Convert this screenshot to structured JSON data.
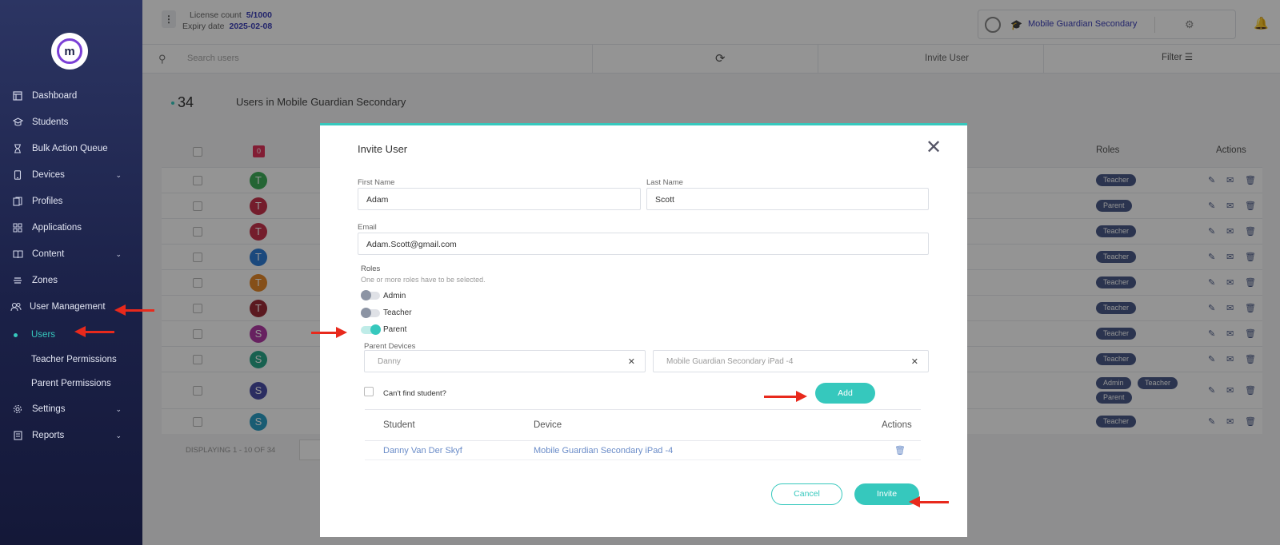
{
  "sidebar": {
    "logo_letter": "m",
    "items": [
      {
        "label": "Dashboard",
        "icon": "dashboard-icon"
      },
      {
        "label": "Students",
        "icon": "students-icon"
      },
      {
        "label": "Bulk Action Queue",
        "icon": "hourglass-icon"
      },
      {
        "label": "Devices",
        "icon": "device-icon"
      },
      {
        "label": "Profiles",
        "icon": "profiles-icon"
      },
      {
        "label": "Applications",
        "icon": "grid-icon"
      },
      {
        "label": "Content",
        "icon": "book-icon"
      },
      {
        "label": "Zones",
        "icon": "zones-icon"
      },
      {
        "label": "User Management",
        "icon": "users-icon"
      },
      {
        "label": "Settings",
        "icon": "gear-icon"
      },
      {
        "label": "Reports",
        "icon": "reports-icon"
      }
    ],
    "sub_items": [
      {
        "label": "Users"
      },
      {
        "label": "Teacher Permissions"
      },
      {
        "label": "Parent Permissions"
      }
    ]
  },
  "topbar": {
    "license_label": "License count",
    "license_value": "5/1000",
    "expiry_label": "Expiry date",
    "expiry_value": "2025-02-08",
    "school_name": "Mobile Guardian Secondary"
  },
  "toolbar": {
    "search_placeholder": "Search users",
    "invite_label": "Invite User",
    "filter_label": "Filter"
  },
  "page": {
    "count": "34",
    "title": "Users in Mobile Guardian Secondary",
    "selected_count": "0",
    "col_roles": "Roles",
    "col_actions": "Actions",
    "footer": "DISPLAYING 1 - 10 OF 34"
  },
  "users": [
    {
      "initial": "T",
      "color": "#3fae5a",
      "roles": [
        "Teacher"
      ]
    },
    {
      "initial": "T",
      "color": "#c8334c",
      "roles": [
        "Parent"
      ]
    },
    {
      "initial": "T",
      "color": "#c8334c",
      "roles": [
        "Teacher"
      ]
    },
    {
      "initial": "T",
      "color": "#2f7ed8",
      "roles": [
        "Teacher"
      ]
    },
    {
      "initial": "T",
      "color": "#e6892a",
      "roles": [
        "Teacher"
      ]
    },
    {
      "initial": "T",
      "color": "#9d2b38",
      "roles": [
        "Teacher"
      ]
    },
    {
      "initial": "S",
      "color": "#b23aa6",
      "roles": [
        "Teacher"
      ]
    },
    {
      "initial": "S",
      "color": "#2aa88a",
      "roles": [
        "Teacher"
      ]
    },
    {
      "initial": "S",
      "color": "#4a4fa8",
      "roles": [
        "Admin",
        "Teacher",
        "Parent"
      ]
    },
    {
      "initial": "S",
      "color": "#2b9fc6",
      "roles": [
        "Teacher"
      ]
    }
  ],
  "modal": {
    "title": "Invite User",
    "first_name_label": "First Name",
    "first_name_value": "Adam",
    "last_name_label": "Last Name",
    "last_name_value": "Scott",
    "email_label": "Email",
    "email_value": "Adam.Scott@gmail.com",
    "roles_label": "Roles",
    "roles_hint": "One or more roles have to be selected.",
    "roles": [
      {
        "label": "Admin",
        "checked": false
      },
      {
        "label": "Teacher",
        "checked": false
      },
      {
        "label": "Parent",
        "checked": true
      }
    ],
    "parent_devices_label": "Parent Devices",
    "student_select": "Danny",
    "device_select": "Mobile Guardian Secondary iPad -4",
    "cant_find_label": "Can't find student?",
    "add_label": "Add",
    "table_student": "Student",
    "table_device": "Device",
    "table_actions": "Actions",
    "rows": [
      {
        "student": "Danny Van Der Skyf",
        "device": "Mobile Guardian Secondary iPad -4"
      }
    ],
    "cancel_label": "Cancel",
    "invite_label": "Invite"
  },
  "colors": {
    "accent": "#36c8bd",
    "sidebar": "#1b2148",
    "annotation": "#e8291c"
  }
}
